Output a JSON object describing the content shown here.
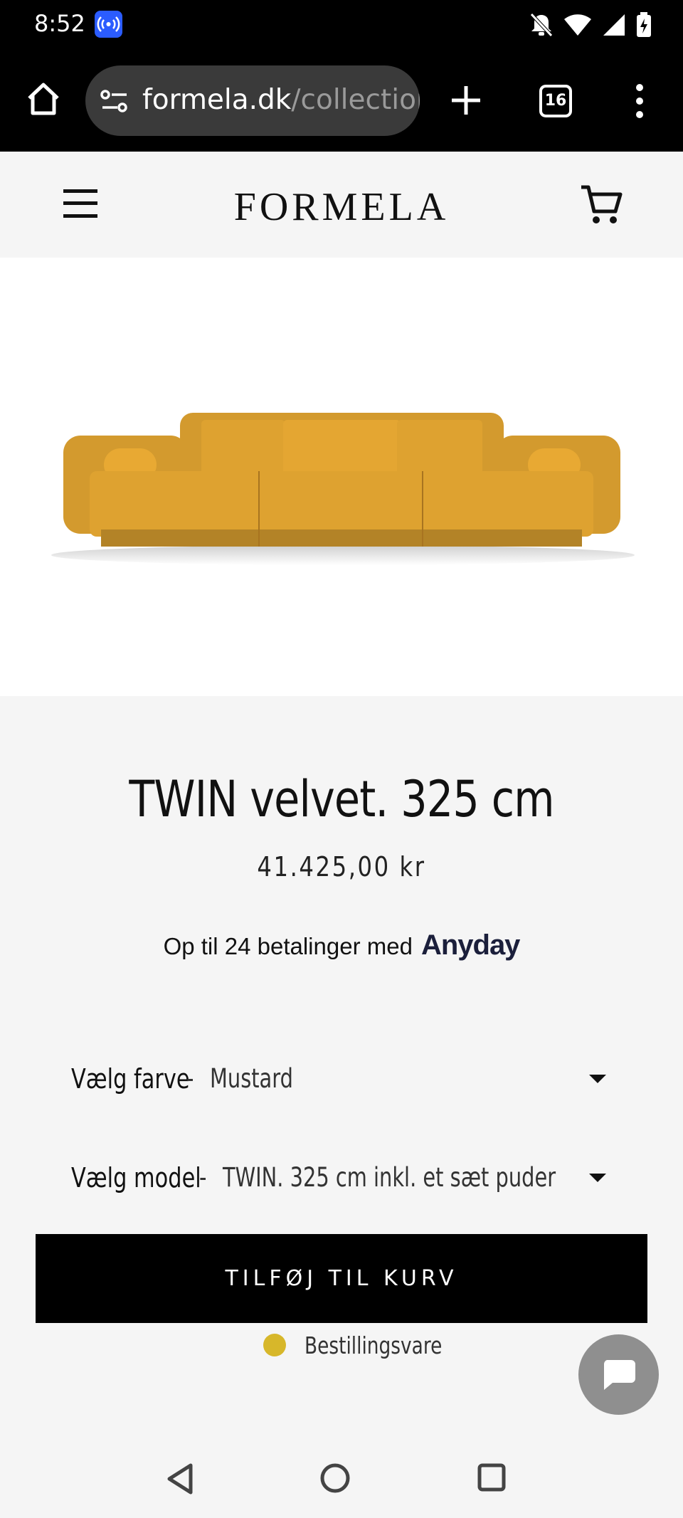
{
  "status_bar": {
    "time": "8:52",
    "icons": [
      "cast-icon",
      "mute-icon",
      "wifi-icon",
      "signal-icon",
      "battery-charging-icon"
    ]
  },
  "browser": {
    "url_domain": "formela.dk",
    "url_path": "/collection",
    "tab_count": "16",
    "icons": [
      "home-icon",
      "site-settings-icon",
      "new-tab-icon",
      "tabs-icon",
      "menu-icon"
    ]
  },
  "header": {
    "logo": "FORMELA",
    "icons": [
      "hamburger-menu-icon",
      "cart-icon"
    ]
  },
  "product": {
    "title": "TWIN velvet. 325 cm",
    "price": "41.425,00 kr",
    "payment_text": "Op til 24 betalinger med",
    "payment_brand": "Anyday",
    "color_label": "Vælg farve",
    "color_value": "Mustard",
    "model_label": "Vælg model",
    "model_value": "TWIN. 325 cm inkl. et sæt puder",
    "separator": "-",
    "add_to_cart": "TILFØJ TIL KURV",
    "stock_label": "Bestillingsvare",
    "stock_color": "#d7b72a",
    "sofa_color": "#d39a2e"
  },
  "colors": {
    "accent": "#000000",
    "background": "#f5f5f5"
  }
}
